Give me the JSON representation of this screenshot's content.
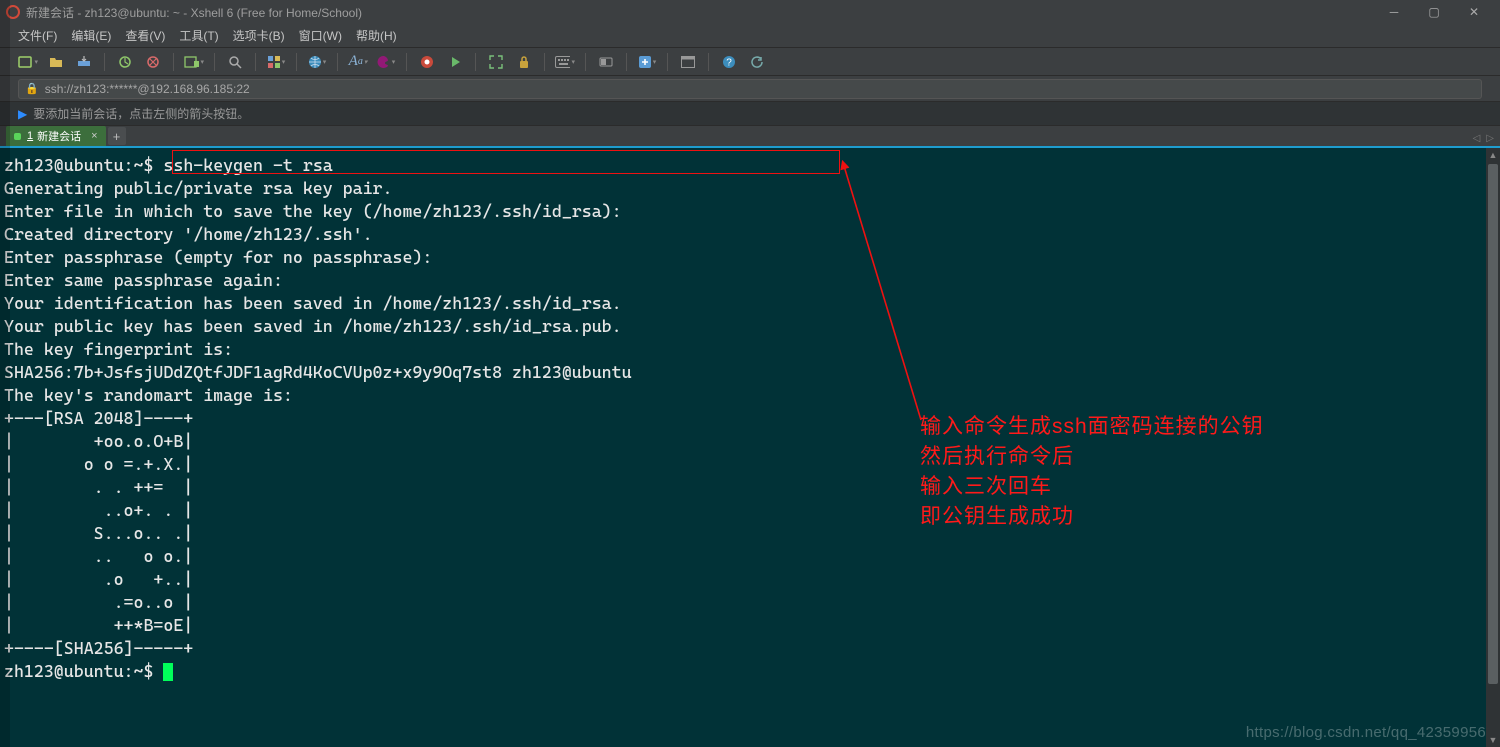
{
  "titlebar": {
    "title": "新建会话 - zh123@ubuntu: ~ - Xshell 6 (Free for Home/School)"
  },
  "menu": {
    "file": "文件(F)",
    "edit": "编辑(E)",
    "view": "查看(V)",
    "tools": "工具(T)",
    "tabs": "选项卡(B)",
    "window": "窗口(W)",
    "help": "帮助(H)"
  },
  "address": {
    "url": "ssh://zh123:******@192.168.96.185:22"
  },
  "hint": {
    "text": "要添加当前会话，点击左侧的箭头按钮。"
  },
  "tab": {
    "index": "1",
    "label": "新建会话"
  },
  "toolbar": {
    "new": "new",
    "open": "open",
    "transfer": "transfer",
    "reconnect": "reconnect",
    "disconnect": "disconnect",
    "addtab": "addtab",
    "search": "search",
    "grid": "grid",
    "globe": "globe",
    "font": "font",
    "palette": "palette",
    "record": "record",
    "play": "play",
    "maximize": "maximize",
    "lock": "lock",
    "keyboard": "keyboard",
    "toggle": "toggle",
    "addbtn": "addbtn",
    "win": "win",
    "help": "help"
  },
  "terminal": {
    "prompt1_user": "zh123@ubuntu",
    "prompt1_sep": ":",
    "prompt1_path": "~",
    "prompt1_sym": "$",
    "command": " ssh-keygen -t rsa",
    "lines": [
      "Generating public/private rsa key pair.",
      "Enter file in which to save the key (/home/zh123/.ssh/id_rsa):",
      "Created directory '/home/zh123/.ssh'.",
      "Enter passphrase (empty for no passphrase):",
      "Enter same passphrase again:",
      "Your identification has been saved in /home/zh123/.ssh/id_rsa.",
      "Your public key has been saved in /home/zh123/.ssh/id_rsa.pub.",
      "The key fingerprint is:",
      "SHA256:7b+JsfsjUDdZQtfJDF1agRd4KoCVUp0z+x9y9Oq7st8 zh123@ubuntu",
      "The key's randomart image is:",
      "+---[RSA 2048]----+",
      "|        +oo.o.O+B|",
      "|       o o =.+.X.|",
      "|        . . ++=  |",
      "|         ..o+. . |",
      "|        S...o.. .|",
      "|        ..   o o.|",
      "|         .o   +..|",
      "|          .=o..o |",
      "|          ++*B=oE|",
      "+----[SHA256]-----+"
    ],
    "prompt2_user": "zh123@ubuntu",
    "prompt2_sep": ":",
    "prompt2_path": "~",
    "prompt2_sym": "$"
  },
  "annotation": {
    "l1": "输入命令生成ssh面密码连接的公钥",
    "l2": "然后执行命令后",
    "l3": "输入三次回车",
    "l4": "即公钥生成成功"
  },
  "watermark": "https://blog.csdn.net/qq_42359956"
}
